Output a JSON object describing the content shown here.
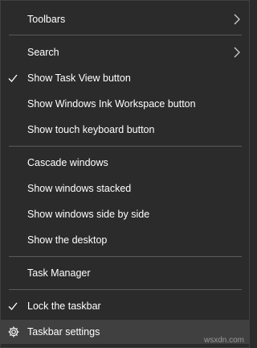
{
  "menu": {
    "items": [
      {
        "id": "toolbars",
        "label": "Toolbars",
        "submenu": true,
        "checked": false
      },
      {
        "id": "search",
        "label": "Search",
        "submenu": true,
        "checked": false
      },
      {
        "id": "show-task-view",
        "label": "Show Task View button",
        "submenu": false,
        "checked": true
      },
      {
        "id": "show-ink-workspace",
        "label": "Show Windows Ink Workspace button",
        "submenu": false,
        "checked": false
      },
      {
        "id": "show-touch-keyboard",
        "label": "Show touch keyboard button",
        "submenu": false,
        "checked": false
      },
      {
        "id": "cascade-windows",
        "label": "Cascade windows",
        "submenu": false,
        "checked": false
      },
      {
        "id": "show-windows-stacked",
        "label": "Show windows stacked",
        "submenu": false,
        "checked": false
      },
      {
        "id": "show-side-by-side",
        "label": "Show windows side by side",
        "submenu": false,
        "checked": false
      },
      {
        "id": "show-desktop",
        "label": "Show the desktop",
        "submenu": false,
        "checked": false
      },
      {
        "id": "task-manager",
        "label": "Task Manager",
        "submenu": false,
        "checked": false
      },
      {
        "id": "lock-taskbar",
        "label": "Lock the taskbar",
        "submenu": false,
        "checked": true
      },
      {
        "id": "taskbar-settings",
        "label": "Taskbar settings",
        "submenu": false,
        "checked": false,
        "icon": "gear-icon",
        "highlighted": true
      }
    ]
  },
  "watermark": "wsxdn.com",
  "colors": {
    "background": "#2b2b2b",
    "hover": "#404040",
    "separator": "#5a5a5a",
    "text": "#ffffff"
  }
}
